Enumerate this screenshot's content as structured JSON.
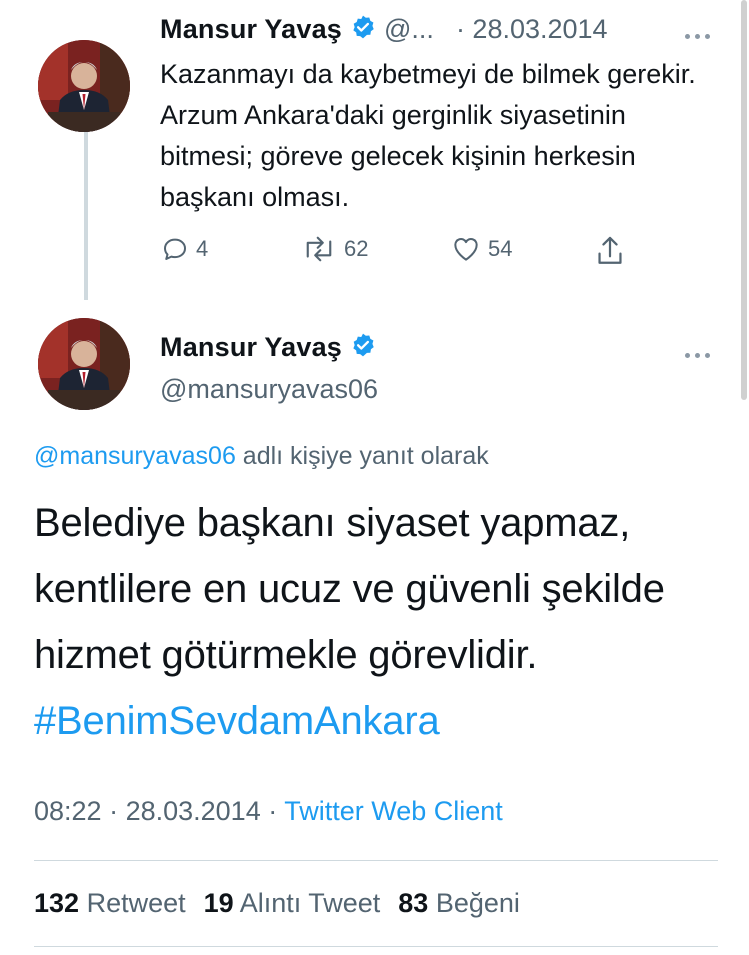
{
  "tweet1": {
    "name": "Mansur Yavaş",
    "handle": "@...",
    "date": "· 28.03.2014",
    "text": "Kazanmayı da kaybetmeyi de bilmek gerekir. Arzum Ankara'daki gerginlik siyasetinin bitmesi; göreve gelecek kişinin herkesin başkanı olması.",
    "replies": "4",
    "retweets": "62",
    "likes": "54"
  },
  "tweet2": {
    "name": "Mansur Yavaş",
    "handle": "@mansuryavas06",
    "reply_to_handle": "@mansuryavas06",
    "reply_to_suffix": " adlı kişiye yanıt olarak",
    "text": "Belediye başkanı siyaset yapmaz, kentlilere en ucuz ve güvenli şekilde hizmet götürmekle görevlidir. ",
    "hashtag": "#BenimSevdamAnkara",
    "time": "08:22",
    "date_sep": " · 28.03.2014 · ",
    "client": "Twitter Web Client",
    "retweet_count": "132",
    "retweet_label": "Retweet",
    "quote_count": "19",
    "quote_label": "Alıntı Tweet",
    "like_count": "83",
    "like_label": "Beğeni"
  },
  "colors": {
    "accent": "#1d9bf0",
    "verified": "#1d9bf0",
    "muted": "#536471"
  },
  "icons": [
    "verified-badge-icon",
    "more-icon",
    "reply-icon",
    "retweet-icon",
    "like-icon",
    "share-icon"
  ]
}
